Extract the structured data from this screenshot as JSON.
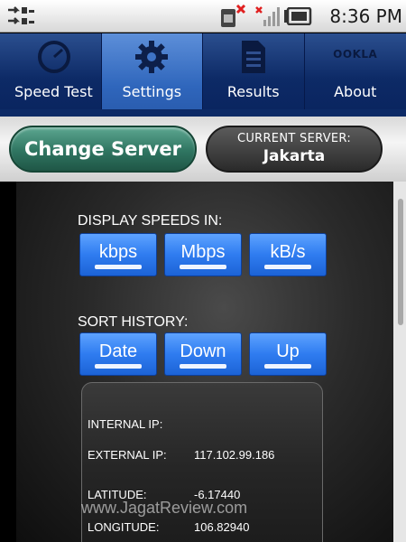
{
  "status_bar": {
    "time": "8:36 PM",
    "icons": [
      "usb-icon",
      "sim-card-icon",
      "signal-icon",
      "battery-icon"
    ]
  },
  "tabs": [
    {
      "label": "Speed Test",
      "icon": "speedometer-icon",
      "active": false
    },
    {
      "label": "Settings",
      "icon": "gear-icon",
      "active": true
    },
    {
      "label": "Results",
      "icon": "document-icon",
      "active": false
    },
    {
      "label": "About",
      "icon": "ookla-logo-icon",
      "active": false,
      "logo_text": "OOKLA"
    }
  ],
  "server": {
    "change_label": "Change Server",
    "current_label": "CURRENT SERVER:",
    "current_value": "Jakarta"
  },
  "display_speeds": {
    "label": "DISPLAY SPEEDS IN:",
    "options": [
      "kbps",
      "Mbps",
      "kB/s"
    ],
    "selected": "kbps"
  },
  "sort_history": {
    "label": "SORT HISTORY:",
    "options": [
      "Date",
      "Down",
      "Up"
    ],
    "selected": "Date"
  },
  "network_info": {
    "internal_ip_label": "INTERNAL IP:",
    "internal_ip": "",
    "external_ip_label": "EXTERNAL IP:",
    "external_ip": "117.102.99.186",
    "latitude_label": "LATITUDE:",
    "latitude": "-6.17440",
    "longitude_label": "LONGITUDE:",
    "longitude": "106.82940"
  },
  "watermark": "www.JagatReview.com",
  "colors": {
    "tab_bar": "#0d2a66",
    "tab_active": "#2f66bc",
    "button_blue": "#2f7cf0",
    "change_server_green": "#2f7561"
  }
}
